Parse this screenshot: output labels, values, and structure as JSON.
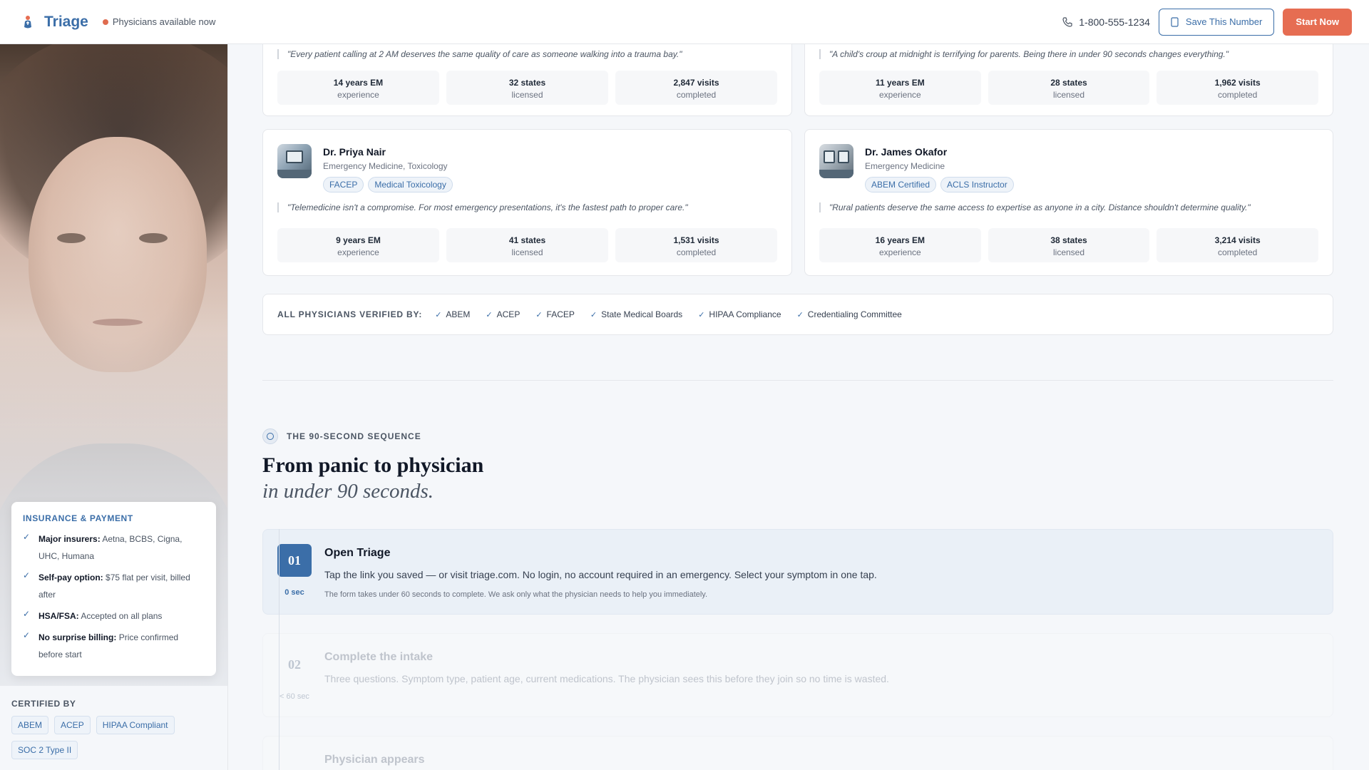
{
  "header": {
    "brand": "Triage",
    "status": "Physicians available now",
    "phone": "1-800-555-1234",
    "save_button": "Save This Number",
    "start_button": "Start Now"
  },
  "insurance": {
    "title": "INSURANCE & PAYMENT",
    "items": [
      {
        "label": "Major insurers:",
        "text": "Aetna, BCBS, Cigna, UHC, Humana"
      },
      {
        "label": "Self-pay option:",
        "text": "$75 flat per visit, billed after"
      },
      {
        "label": "HSA/FSA:",
        "text": "Accepted on all plans"
      },
      {
        "label": "No surprise billing:",
        "text": "Price confirmed before start"
      }
    ]
  },
  "certified": {
    "title": "CERTIFIED BY",
    "tags": [
      "ABEM",
      "ACEP",
      "HIPAA Compliant",
      "SOC 2 Type II"
    ]
  },
  "doctors": [
    {
      "quote": "\"Every patient calling at 2 AM deserves the same quality of care as someone walking into a trauma bay.\"",
      "stats": [
        {
          "value": "14 years EM",
          "label": "experience"
        },
        {
          "value": "32 states",
          "label": "licensed"
        },
        {
          "value": "2,847 visits",
          "label": "completed"
        }
      ]
    },
    {
      "quote": "\"A child's croup at midnight is terrifying for parents. Being there in under 90 seconds changes everything.\"",
      "stats": [
        {
          "value": "11 years EM",
          "label": "experience"
        },
        {
          "value": "28 states",
          "label": "licensed"
        },
        {
          "value": "1,962 visits",
          "label": "completed"
        }
      ]
    },
    {
      "name": "Dr. Priya Nair",
      "specialty": "Emergency Medicine, Toxicology",
      "tags": [
        "FACEP",
        "Medical Toxicology"
      ],
      "quote": "\"Telemedicine isn't a compromise. For most emergency presentations, it's the fastest path to proper care.\"",
      "stats": [
        {
          "value": "9 years EM",
          "label": "experience"
        },
        {
          "value": "41 states",
          "label": "licensed"
        },
        {
          "value": "1,531 visits",
          "label": "completed"
        }
      ]
    },
    {
      "name": "Dr. James Okafor",
      "specialty": "Emergency Medicine",
      "tags": [
        "ABEM Certified",
        "ACLS Instructor"
      ],
      "quote": "\"Rural patients deserve the same access to expertise as anyone in a city. Distance shouldn't determine quality.\"",
      "stats": [
        {
          "value": "16 years EM",
          "label": "experience"
        },
        {
          "value": "38 states",
          "label": "licensed"
        },
        {
          "value": "3,214 visits",
          "label": "completed"
        }
      ]
    }
  ],
  "verification": {
    "label": "ALL PHYSICIANS VERIFIED BY:",
    "items": [
      "ABEM",
      "ACEP",
      "FACEP",
      "State Medical Boards",
      "HIPAA Compliance",
      "Credentialing Committee"
    ]
  },
  "sequence": {
    "eyebrow": "THE 90-SECOND SEQUENCE",
    "title": "From panic to physician",
    "subtitle": "in under 90 seconds.",
    "steps": [
      {
        "num": "01",
        "time": "0 sec",
        "title": "Open Triage",
        "desc": "Tap the link you saved — or visit triage.com. No login, no account required in an emergency. Select your symptom in one tap.",
        "note": "The form takes under 60 seconds to complete. We ask only what the physician needs to help you immediately."
      },
      {
        "num": "02",
        "time": "< 60 sec",
        "title": "Complete the intake",
        "desc": "Three questions. Symptom type, patient age, current medications. The physician sees this before they join so no time is wasted."
      },
      {
        "num": "03",
        "title": "Physician appears"
      }
    ]
  }
}
